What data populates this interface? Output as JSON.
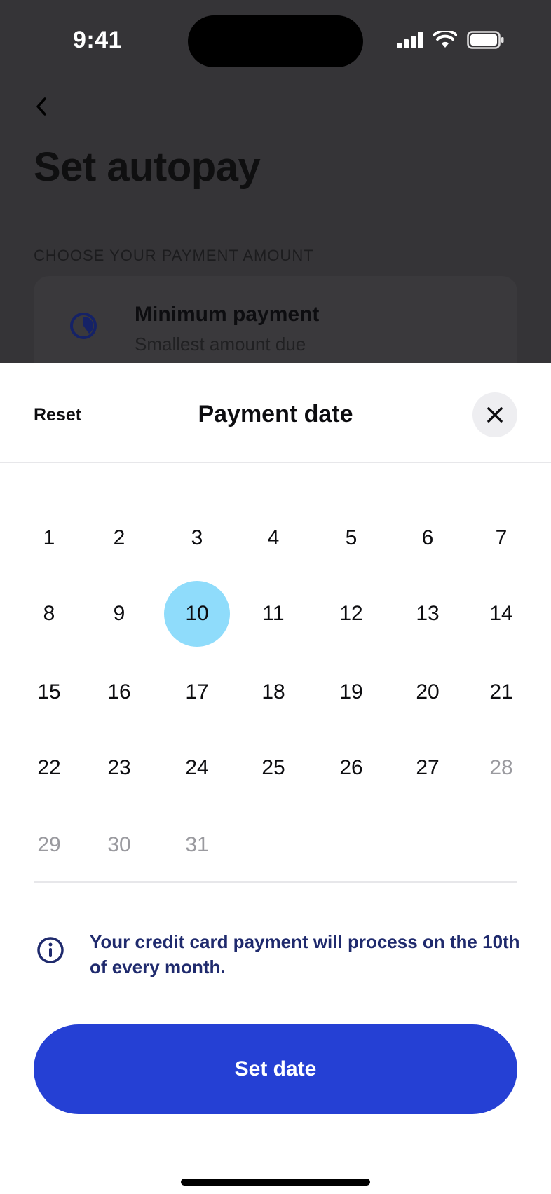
{
  "status_bar": {
    "time": "9:41"
  },
  "background_screen": {
    "title": "Set autopay",
    "section_label": "CHOOSE YOUR PAYMENT AMOUNT",
    "option": {
      "title": "Minimum payment",
      "subtitle": "Smallest amount due"
    }
  },
  "sheet": {
    "reset_label": "Reset",
    "title": "Payment date",
    "calendar": {
      "days": [
        "1",
        "2",
        "3",
        "4",
        "5",
        "6",
        "7",
        "8",
        "9",
        "10",
        "11",
        "12",
        "13",
        "14",
        "15",
        "16",
        "17",
        "18",
        "19",
        "20",
        "21",
        "22",
        "23",
        "24",
        "25",
        "26",
        "27",
        "28",
        "29",
        "30",
        "31"
      ],
      "selected_day": "10",
      "disabled_days": [
        "28",
        "29",
        "30",
        "31"
      ]
    },
    "info_text": "Your credit card payment will process on the 10th of every month.",
    "set_date_label": "Set date"
  },
  "colors": {
    "accent": "#2540d4",
    "selected_day": "#8fdcfb",
    "info_text": "#1f2a6d",
    "disabled_day": "#9a9a9f"
  },
  "icons": {
    "back": "chevron-left-icon",
    "option": "clock-icon",
    "close": "close-icon",
    "info": "info-icon"
  }
}
